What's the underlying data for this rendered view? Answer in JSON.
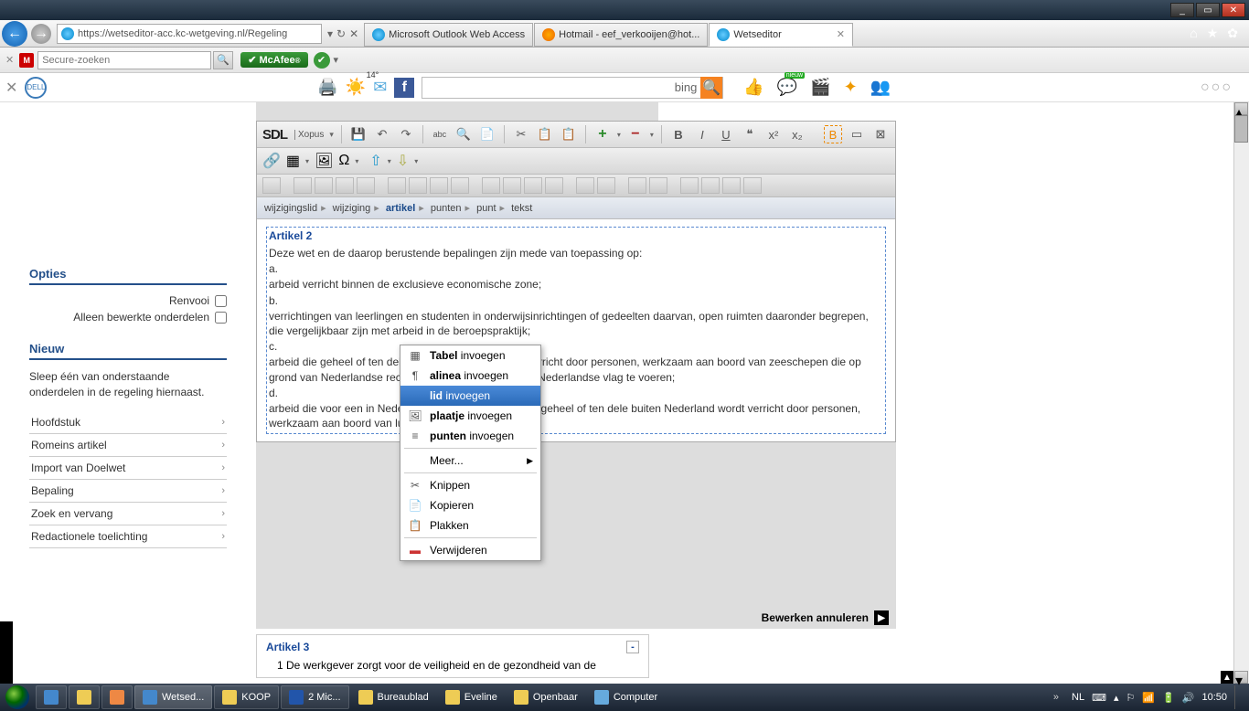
{
  "titlebar": {
    "min": "_",
    "max": "▭",
    "close": "✕"
  },
  "nav": {
    "url": "https://wetseditor-acc.kc-wetgeving.nl/Regeling",
    "tabs": [
      {
        "label": "Microsoft Outlook Web Access"
      },
      {
        "label": "Hotmail - eef_verkooijen@hot..."
      },
      {
        "label": "Wetseditor"
      }
    ]
  },
  "mcafee": {
    "placeholder": "Secure-zoeken",
    "brand": "McAfee"
  },
  "dell": {
    "temp": "14°",
    "bing": "bing"
  },
  "sidebar": {
    "opties_title": "Opties",
    "opt1": "Renvooi",
    "opt2": "Alleen bewerkte onderdelen",
    "nieuw_title": "Nieuw",
    "nieuw_desc": "Sleep één van onderstaande onderdelen in de regeling hiernaast.",
    "items": [
      "Hoofdstuk",
      "Romeins artikel",
      "Import van Doelwet",
      "Bepaling",
      "Zoek en vervang",
      "Redactionele toelichting"
    ]
  },
  "editor": {
    "brand": "SDL",
    "sub": "Xopus",
    "breadcrumb": [
      "wijzigingslid",
      "wijziging",
      "artikel",
      "punten",
      "punt",
      "tekst"
    ],
    "article": {
      "title": "Artikel 2",
      "intro": "Deze wet en de daarop berustende bepalingen zijn mede van toepassing op:",
      "a": "a.",
      "a_txt": "arbeid verricht binnen de exclusieve economische zone;",
      "b": "b.",
      "b_txt": "verrichtingen van leerlingen en studenten in onderwijsinrichtingen of gedeelten daarvan, open ruimten daaronder begrepen, die vergelijkbaar zijn met arbeid in de beroepspraktijk;",
      "c": "c.",
      "c_txt": "arbeid die geheel of ten dele buiten Nederland wordt verricht door personen, werkzaam aan boord van zeeschepen die op grond van Nederlandse rechtsregels gerechtigd zijn de Nederlandse vlag te voeren;",
      "d": "d.",
      "d_txt": "arbeid die voor een in Nederland gevestigde werkgever geheel of ten dele buiten Nederland wordt verricht door personen, werkzaam aan boord van luchtvaartuigen."
    },
    "cancel": "Bewerken annuleren",
    "art3": {
      "title": "Artikel 3",
      "line": "1 De werkgever zorgt voor de veiligheid en de gezondheid van de"
    }
  },
  "ctx": {
    "tabel": "Tabel",
    "tabel2": "invoegen",
    "alinea": "alinea",
    "alinea2": "invoegen",
    "lid": "lid",
    "lid2": "invoegen",
    "plaatje": "plaatje",
    "plaatje2": "invoegen",
    "punten": "punten",
    "punten2": "invoegen",
    "meer": "Meer...",
    "knippen": "Knippen",
    "kopieren": "Kopieren",
    "plakken": "Plakken",
    "verwijderen": "Verwijderen"
  },
  "taskbar": {
    "items": [
      {
        "label": "Wetsed..."
      },
      {
        "label": "KOOP"
      },
      {
        "label": "2 Mic..."
      },
      {
        "label": "Bureaublad"
      },
      {
        "label": "Eveline"
      },
      {
        "label": "Openbaar"
      },
      {
        "label": "Computer"
      }
    ],
    "lang": "NL",
    "clock": "10:50"
  }
}
